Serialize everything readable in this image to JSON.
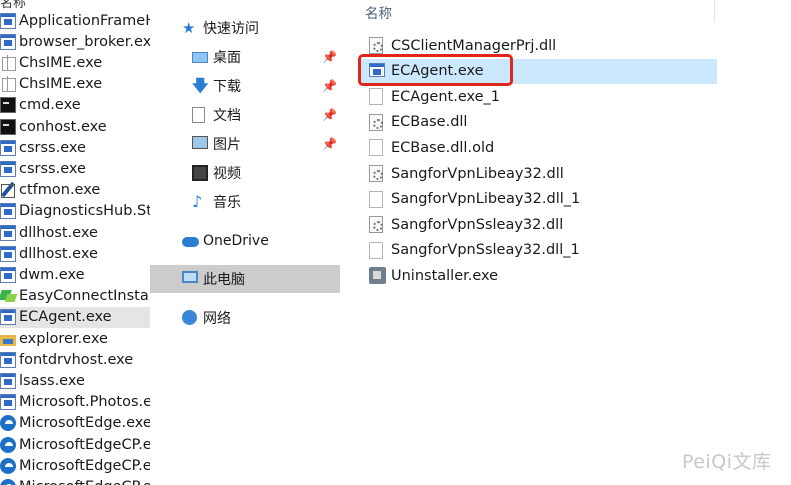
{
  "process_list": {
    "header": "名称",
    "items": [
      {
        "name": "ApplicationFrameH",
        "icon": "window-app-icon"
      },
      {
        "name": "browser_broker.exe",
        "icon": "window-app-icon"
      },
      {
        "name": "ChsIME.exe",
        "icon": "ime-icon"
      },
      {
        "name": "ChsIME.exe",
        "icon": "ime-icon"
      },
      {
        "name": "cmd.exe",
        "icon": "cmd-icon"
      },
      {
        "name": "conhost.exe",
        "icon": "cmd-icon"
      },
      {
        "name": "csrss.exe",
        "icon": "window-app-icon"
      },
      {
        "name": "csrss.exe",
        "icon": "window-app-icon"
      },
      {
        "name": "ctfmon.exe",
        "icon": "pen-icon"
      },
      {
        "name": "DiagnosticsHub.Sta",
        "icon": "window-app-icon"
      },
      {
        "name": "dllhost.exe",
        "icon": "window-app-icon"
      },
      {
        "name": "dllhost.exe",
        "icon": "window-app-icon"
      },
      {
        "name": "dwm.exe",
        "icon": "window-app-icon"
      },
      {
        "name": "EasyConnectInstalle",
        "icon": "easyconnect-icon"
      },
      {
        "name": "ECAgent.exe",
        "icon": "window-app-icon",
        "selected": true
      },
      {
        "name": "explorer.exe",
        "icon": "folder-icon"
      },
      {
        "name": "fontdrvhost.exe",
        "icon": "window-app-icon"
      },
      {
        "name": "lsass.exe",
        "icon": "window-app-icon"
      },
      {
        "name": "Microsoft.Photos.ex",
        "icon": "window-app-icon"
      },
      {
        "name": "MicrosoftEdge.exe",
        "icon": "edge-icon"
      },
      {
        "name": "MicrosoftEdgeCP.e",
        "icon": "edge-icon"
      },
      {
        "name": "MicrosoftEdgeCP.e",
        "icon": "edge-icon"
      },
      {
        "name": "MicrosoftEdgeCP.e",
        "icon": "edge-icon"
      }
    ]
  },
  "nav": {
    "items": [
      {
        "label": "快速访问",
        "icon": "star-icon",
        "pinned": false
      },
      {
        "label": "桌面",
        "icon": "desktop-icon",
        "pinned": true
      },
      {
        "label": "下载",
        "icon": "download-icon",
        "pinned": true
      },
      {
        "label": "文档",
        "icon": "document-icon",
        "pinned": true
      },
      {
        "label": "图片",
        "icon": "pictures-icon",
        "pinned": true
      },
      {
        "label": "视频",
        "icon": "video-icon",
        "pinned": false
      },
      {
        "label": "音乐",
        "icon": "music-icon",
        "pinned": false
      },
      {
        "label": "OneDrive",
        "icon": "cloud-icon",
        "pinned": false
      },
      {
        "label": "此电脑",
        "icon": "computer-icon",
        "pinned": false,
        "selected": true
      },
      {
        "label": "网络",
        "icon": "network-icon",
        "pinned": false
      }
    ]
  },
  "files": {
    "header": "名称",
    "items": [
      {
        "name": "CSClientManagerPrj.dll",
        "icon": "dll-file-icon"
      },
      {
        "name": "ECAgent.exe",
        "icon": "exe-file-icon",
        "selected": true,
        "highlighted": true
      },
      {
        "name": "ECAgent.exe_1",
        "icon": "blank-file-icon"
      },
      {
        "name": "ECBase.dll",
        "icon": "dll-file-icon"
      },
      {
        "name": "ECBase.dll.old",
        "icon": "blank-file-icon"
      },
      {
        "name": "SangforVpnLibeay32.dll",
        "icon": "dll-file-icon"
      },
      {
        "name": "SangforVpnLibeay32.dll_1",
        "icon": "blank-file-icon"
      },
      {
        "name": "SangforVpnSsleay32.dll",
        "icon": "dll-file-icon"
      },
      {
        "name": "SangforVpnSsleay32.dll_1",
        "icon": "blank-file-icon"
      },
      {
        "name": "Uninstaller.exe",
        "icon": "uninstaller-icon"
      }
    ]
  },
  "watermark": "PeiQi文库",
  "colors": {
    "selection": "#cce8ff",
    "nav_selection": "#cccccc",
    "highlight_border": "#e0261b"
  }
}
